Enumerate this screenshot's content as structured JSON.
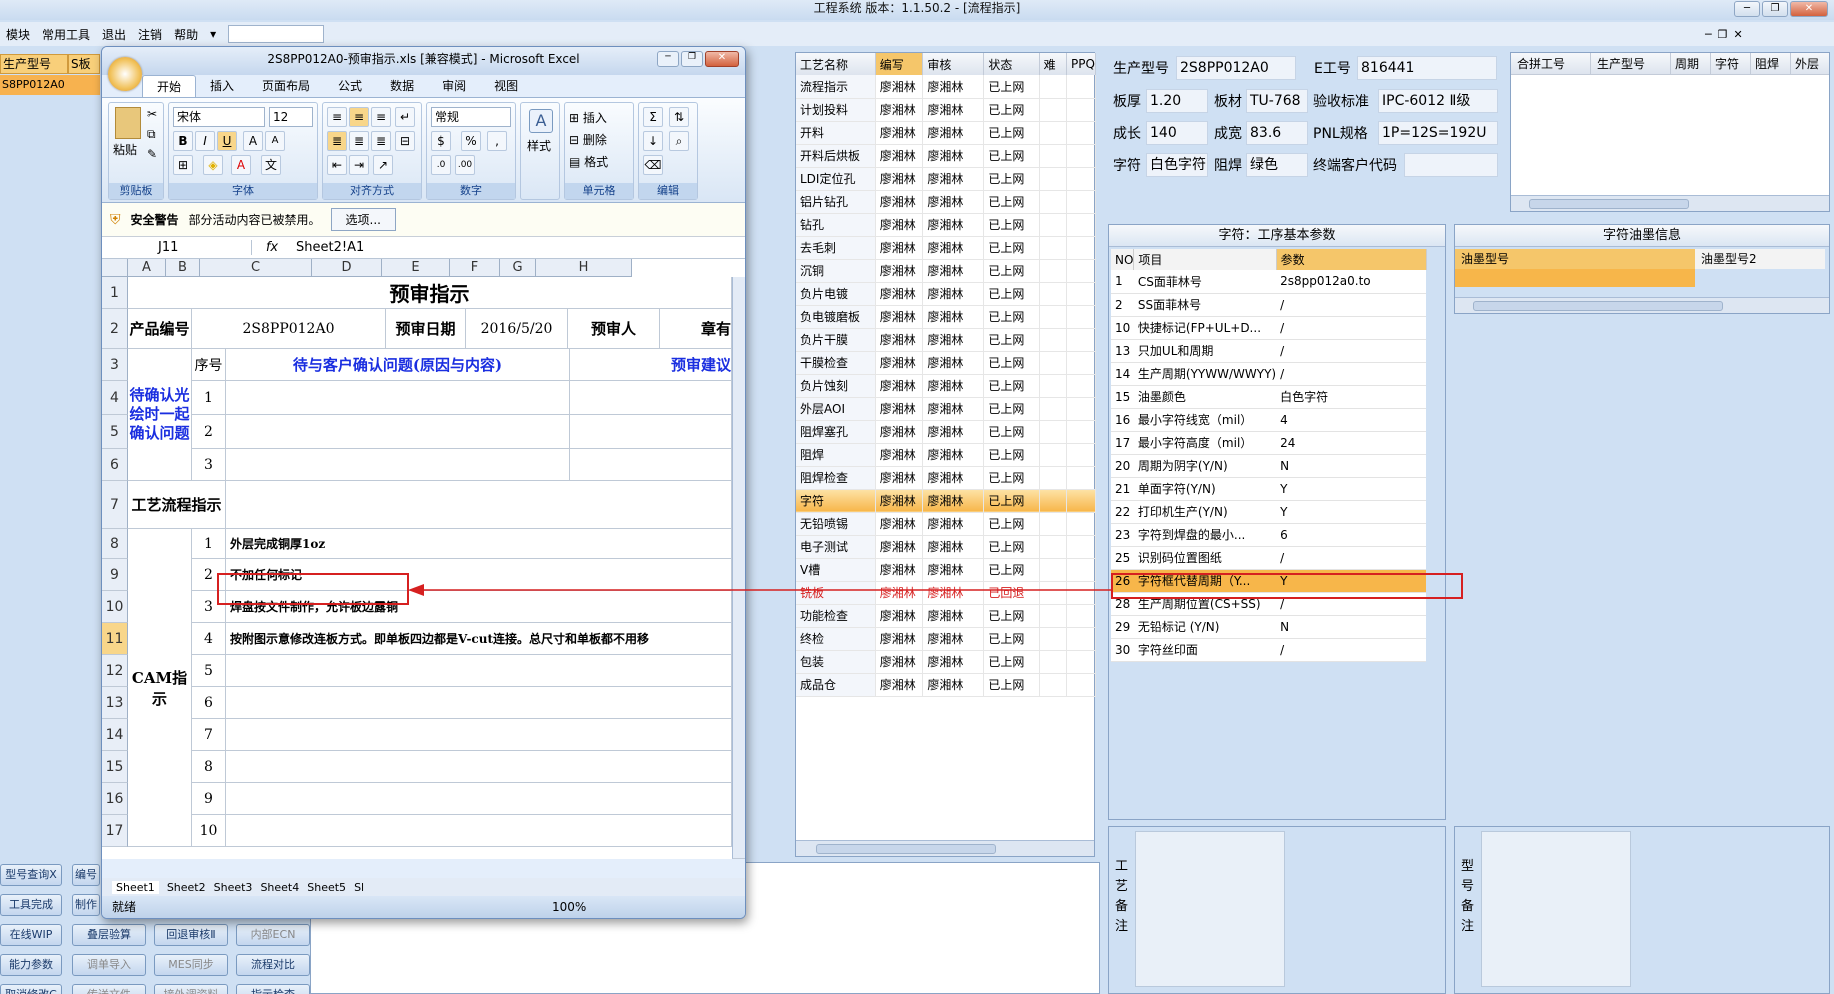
{
  "app": {
    "title": "工程系统  版本：1.1.50.2 - [流程指示]"
  },
  "menu": [
    "模块",
    "常用工具",
    "退出",
    "注销",
    "帮助"
  ],
  "left": {
    "col1": "生产型号",
    "col2": "S板",
    "row1": "S8PP012A0",
    "buttons": [
      "型号查询Ⅹ",
      "编号",
      "工具完成",
      "制作",
      "在线WIP",
      "叠层验算",
      "回退审核Ⅱ",
      "内部ECN",
      "能力参数",
      "调单导入",
      "MES同步",
      "流程对比",
      "取消修改C",
      "传送文件",
      "接外调资料",
      "指示检查"
    ]
  },
  "excel": {
    "title": "2S8PP012A0-预审指示.xls  [兼容模式] - Microsoft Excel",
    "tabs": [
      "开始",
      "插入",
      "页面布局",
      "公式",
      "数据",
      "审阅",
      "视图"
    ],
    "ribbon": {
      "paste": "粘贴",
      "font": "宋体",
      "size": "12",
      "number_format": "常规",
      "style": "样式",
      "groups": [
        "剪贴板",
        "字体",
        "对齐方式",
        "数字",
        "单元格",
        "编辑"
      ],
      "insert": "插入",
      "delete": "删除",
      "format": "格式"
    },
    "security": {
      "label": "安全警告",
      "text": "部分活动内容已被禁用。",
      "button": "选项..."
    },
    "namebox": "J11",
    "formula": "Sheet2!A1",
    "cols": [
      "A",
      "B",
      "C",
      "D",
      "E",
      "F",
      "G",
      "H"
    ],
    "rows": [
      "1",
      "2",
      "3",
      "4",
      "5",
      "6",
      "7",
      "8",
      "9",
      "10",
      "11",
      "12",
      "13",
      "14",
      "15",
      "16",
      "17"
    ],
    "sheet": {
      "title": "预审指示",
      "label_product": "产品编号",
      "product": "2S8PP012A0",
      "label_date": "预审日期",
      "date": "2016/5/20",
      "label_reviewer": "预审人",
      "chapter": "章有",
      "seq_label": "序号",
      "issue_header": "待与客户确认问题(原因与内容)",
      "suggest_header": "预审建议",
      "confirm_label": "待确认光绘时一起确认问题",
      "flow_label": "工艺流程指示",
      "cam_label": "CAM指示",
      "items": [
        {
          "no": "1",
          "text": "外层完成铜厚1oz"
        },
        {
          "no": "2",
          "text": "不加任何标记"
        },
        {
          "no": "3",
          "text": "焊盘按文件制作，允许板边露铜"
        },
        {
          "no": "4",
          "text": "按附图示意修改连板方式。即单板四边都是V-cut连接。总尺寸和单板都不用移"
        },
        {
          "no": "5",
          "text": ""
        },
        {
          "no": "6",
          "text": ""
        },
        {
          "no": "7",
          "text": ""
        },
        {
          "no": "8",
          "text": ""
        },
        {
          "no": "9",
          "text": ""
        },
        {
          "no": "10",
          "text": ""
        }
      ]
    },
    "sheettabs": [
      "Sheet1",
      "Sheet2",
      "Sheet3",
      "Sheet4",
      "Sheet5",
      "Sl"
    ],
    "status": "就绪",
    "zoom": "100%"
  },
  "process": {
    "headers": [
      "工艺名称",
      "编写",
      "审核",
      "状态",
      "难",
      "PPQ"
    ],
    "rows": [
      [
        "流程指示",
        "廖湘林",
        "廖湘林",
        "已上网"
      ],
      [
        "计划投料",
        "廖湘林",
        "廖湘林",
        "已上网"
      ],
      [
        "开料",
        "廖湘林",
        "廖湘林",
        "已上网"
      ],
      [
        "开料后烘板",
        "廖湘林",
        "廖湘林",
        "已上网"
      ],
      [
        "LDI定位孔",
        "廖湘林",
        "廖湘林",
        "已上网"
      ],
      [
        "铝片钻孔",
        "廖湘林",
        "廖湘林",
        "已上网"
      ],
      [
        "钻孔",
        "廖湘林",
        "廖湘林",
        "已上网"
      ],
      [
        "去毛刺",
        "廖湘林",
        "廖湘林",
        "已上网"
      ],
      [
        "沉铜",
        "廖湘林",
        "廖湘林",
        "已上网"
      ],
      [
        "负片电镀",
        "廖湘林",
        "廖湘林",
        "已上网"
      ],
      [
        "负电镀磨板",
        "廖湘林",
        "廖湘林",
        "已上网"
      ],
      [
        "负片干膜",
        "廖湘林",
        "廖湘林",
        "已上网"
      ],
      [
        "干膜检查",
        "廖湘林",
        "廖湘林",
        "已上网"
      ],
      [
        "负片蚀刻",
        "廖湘林",
        "廖湘林",
        "已上网"
      ],
      [
        "外层AOI",
        "廖湘林",
        "廖湘林",
        "已上网"
      ],
      [
        "阻焊塞孔",
        "廖湘林",
        "廖湘林",
        "已上网"
      ],
      [
        "阻焊",
        "廖湘林",
        "廖湘林",
        "已上网"
      ],
      [
        "阻焊检查",
        "廖湘林",
        "廖湘林",
        "已上网"
      ],
      [
        "字符",
        "廖湘林",
        "廖湘林",
        "已上网"
      ],
      [
        "无铅喷锡",
        "廖湘林",
        "廖湘林",
        "已上网"
      ],
      [
        "电子测试",
        "廖湘林",
        "廖湘林",
        "已上网"
      ],
      [
        "V槽",
        "廖湘林",
        "廖湘林",
        "已上网"
      ],
      [
        "铣板",
        "廖湘林",
        "廖湘林",
        "已回退"
      ],
      [
        "功能检查",
        "廖湘林",
        "廖湘林",
        "已上网"
      ],
      [
        "终检",
        "廖湘林",
        "廖湘林",
        "已上网"
      ],
      [
        "包装",
        "廖湘林",
        "廖湘林",
        "已上网"
      ],
      [
        "成品仓",
        "廖湘林",
        "廖湘林",
        "已上网"
      ]
    ]
  },
  "info": {
    "model_label": "生产型号",
    "model": "2S8PP012A0",
    "eno_label": "E工号",
    "eno": "816441",
    "thick_label": "板厚",
    "thick": "1.20",
    "mat_label": "板材",
    "mat": "TU-768",
    "std_label": "验收标准",
    "std": "IPC-6012 Ⅱ级",
    "len_label": "成长",
    "len": "140",
    "wid_label": "成宽",
    "wid": "83.6",
    "pnl_label": "PNL规格",
    "pnl": "1P=12S=192U",
    "char_label": "字符",
    "char": "白色字符",
    "mask_label": "阻焊",
    "mask": "绿色",
    "cust_label": "终端客户代码",
    "cust": ""
  },
  "merge": {
    "headers": [
      "合拼工号",
      "生产型号",
      "周期",
      "字符",
      "阻焊",
      "外层"
    ]
  },
  "params": {
    "title": "字符：工序基本参数",
    "headers": [
      "NO",
      "项目",
      "参数"
    ],
    "rows": [
      [
        "1",
        "CS面菲林号",
        "2s8pp012a0.to"
      ],
      [
        "2",
        "SS面菲林号",
        "/"
      ],
      [
        "10",
        "快捷标记(FP+UL+D...",
        "/"
      ],
      [
        "13",
        "只加UL和周期",
        "/"
      ],
      [
        "14",
        "生产周期(YYWW/WWYY)",
        "/"
      ],
      [
        "15",
        "油墨颜色",
        "白色字符"
      ],
      [
        "16",
        "最小字符线宽（mil）",
        "4"
      ],
      [
        "17",
        "最小字符高度（mil）",
        "24"
      ],
      [
        "20",
        "周期为阴字(Y/N)",
        "N"
      ],
      [
        "21",
        "单面字符(Y/N)",
        "Y"
      ],
      [
        "22",
        "打印机生产(Y/N)",
        "Y"
      ],
      [
        "23",
        "字符到焊盘的最小...",
        "6"
      ],
      [
        "25",
        "识别码位置图纸",
        "/"
      ],
      [
        "26",
        "字符框代替周期（Y...",
        "Y"
      ],
      [
        "28",
        "生产周期位置(CS+SS)",
        "/"
      ],
      [
        "29",
        "无铅标记 (Y/N)",
        "N"
      ],
      [
        "30",
        "字符丝印面",
        "/"
      ]
    ]
  },
  "ink": {
    "title": "字符油墨信息",
    "h1": "油墨型号",
    "h2": "油墨型号2"
  },
  "notes": {
    "proc_label": "工艺备注",
    "model_label": "型号备注"
  },
  "colors": {
    "accent": "#f7b64a",
    "highlight_box": "#d62020"
  }
}
